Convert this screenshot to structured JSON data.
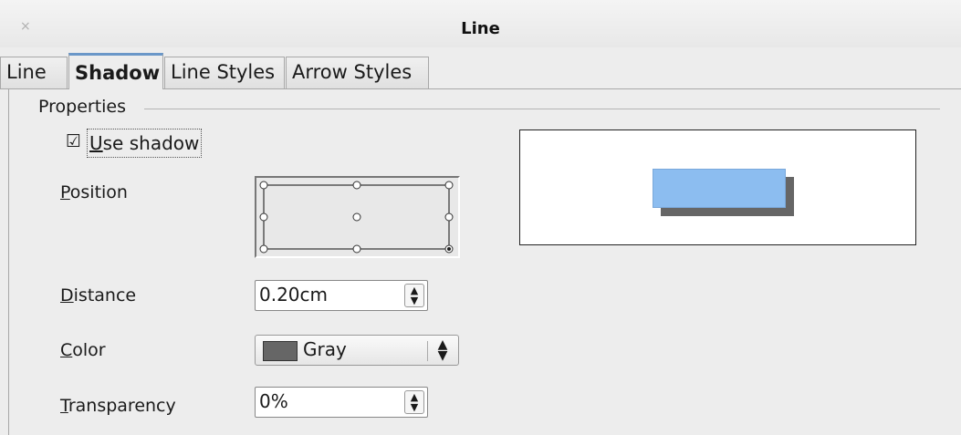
{
  "window": {
    "title": "Line",
    "close_glyph": "×"
  },
  "tabs": [
    {
      "label": "Line",
      "active": false
    },
    {
      "label": "Shadow",
      "active": true
    },
    {
      "label": "Line Styles",
      "active": false
    },
    {
      "label": "Arrow Styles",
      "active": false
    }
  ],
  "properties": {
    "section_label": "Properties",
    "use_shadow": {
      "label": "Use shadow",
      "checked": true,
      "glyph": "☑"
    },
    "position": {
      "label": "Position",
      "selected": "bottom-right"
    },
    "distance": {
      "label": "Distance",
      "value": "0.20cm"
    },
    "color": {
      "label": "Color",
      "value": "Gray",
      "swatch": "#666666"
    },
    "transparency": {
      "label": "Transparency",
      "value": "0%"
    }
  },
  "icons": {
    "spin_up": "▲",
    "spin_down": "▼",
    "select_arrows": "⌃⌄"
  },
  "preview": {
    "object_color": "#8cbdf0",
    "shadow_color": "#666666"
  }
}
